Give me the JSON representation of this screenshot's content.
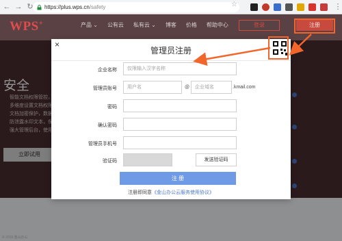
{
  "browser": {
    "url_host": "https://plus.wps.cn",
    "url_path": "/safety"
  },
  "site": {
    "logo": "WPS",
    "logo_mark": "+",
    "nav": [
      "产品 ⌄",
      "公有云",
      "私有云 ⌄",
      "博客",
      "价格",
      "帮助中心"
    ],
    "login_label": "登录",
    "register_label": "注册"
  },
  "hero": {
    "title": "安全",
    "desc_lines": [
      "智能文档权限管控，",
      "多维度设置文档权限",
      "文档加密保护，数据",
      "防泄露水印文本，保",
      "强大管理后台，使用"
    ],
    "cta_label": "立即试用"
  },
  "footer_text": "© 2019 金山办公",
  "modal": {
    "title": "管理员注册",
    "close": "×",
    "fields": {
      "company_label": "企业名称",
      "company_placeholder": "仅限输入汉字名称",
      "account_label": "管理员账号",
      "username_placeholder": "用户名",
      "at": "@",
      "domain_placeholder": "企业域名",
      "domain_suffix": ".kmail.com",
      "password_label": "密码",
      "confirm_label": "确认密码",
      "phone_label": "管理员手机号",
      "captcha_label": "验证码",
      "send_code_label": "发送验证码"
    },
    "submit_label": "注 册",
    "agree_prefix": "注册即同意",
    "agree_link": "《金山办公云服务使用协议》"
  },
  "colors": {
    "brand_red": "#c84a3f",
    "annotation_orange": "#f2652b",
    "primary_blue": "#6f9be6"
  }
}
